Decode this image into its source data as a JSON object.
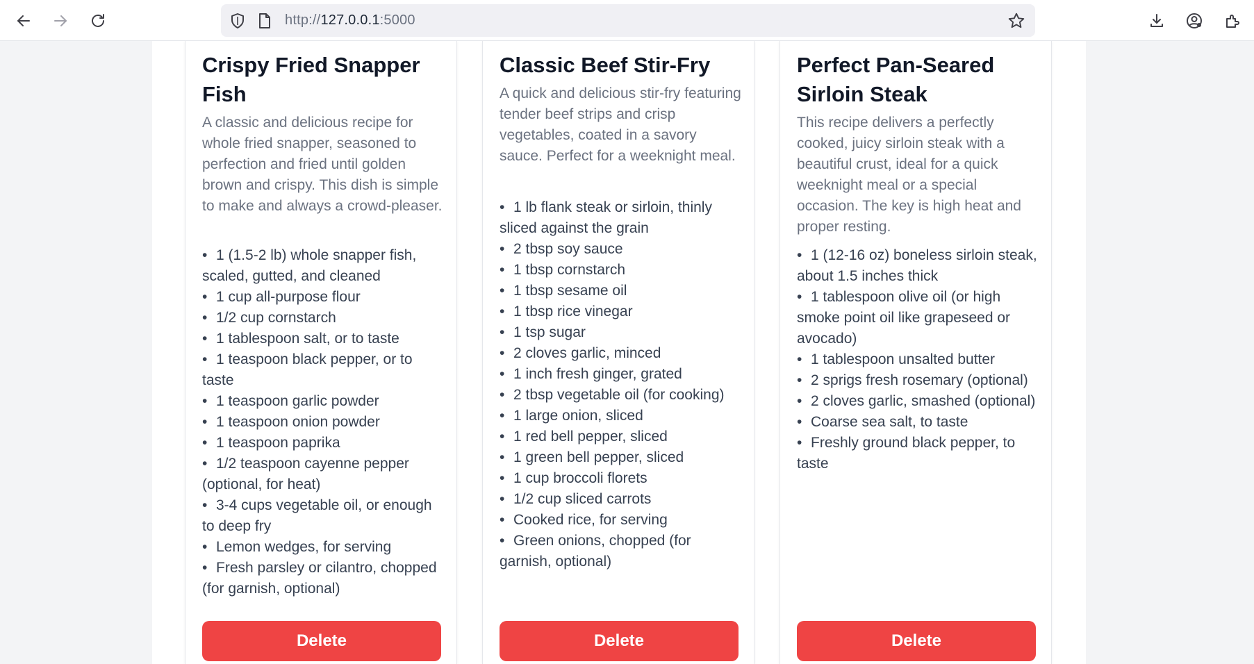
{
  "browser": {
    "url_prefix": "http://",
    "url_host": "127.0.0.1",
    "url_port": ":5000"
  },
  "recipes": [
    {
      "title": "Crispy Fried Snapper Fish",
      "description": "A classic and delicious recipe for whole fried snapper, seasoned to perfection and fried until golden brown and crispy. This dish is simple to make and always a crowd-pleaser.",
      "ingredients": [
        "1 (1.5-2 lb) whole snapper fish, scaled, gutted, and cleaned",
        "1 cup all-purpose flour",
        "1/2 cup cornstarch",
        "1 tablespoon salt, or to taste",
        "1 teaspoon black pepper, or to taste",
        "1 teaspoon garlic powder",
        "1 teaspoon onion powder",
        "1 teaspoon paprika",
        "1/2 teaspoon cayenne pepper (optional, for heat)",
        "3-4 cups vegetable oil, or enough to deep fry",
        "Lemon wedges, for serving",
        "Fresh parsley or cilantro, chopped (for garnish, optional)"
      ],
      "delete_label": "Delete"
    },
    {
      "title": "Classic Beef Stir-Fry",
      "description": "A quick and delicious stir-fry featuring tender beef strips and crisp vegetables, coated in a savory sauce. Perfect for a weeknight meal.",
      "ingredients": [
        "1 lb flank steak or sirloin, thinly sliced against the grain",
        "2 tbsp soy sauce",
        "1 tbsp cornstarch",
        "1 tbsp sesame oil",
        "1 tbsp rice vinegar",
        "1 tsp sugar",
        "2 cloves garlic, minced",
        "1 inch fresh ginger, grated",
        "2 tbsp vegetable oil (for cooking)",
        "1 large onion, sliced",
        "1 red bell pepper, sliced",
        "1 green bell pepper, sliced",
        "1 cup broccoli florets",
        "1/2 cup sliced carrots",
        "Cooked rice, for serving",
        "Green onions, chopped (for garnish, optional)"
      ],
      "delete_label": "Delete"
    },
    {
      "title": "Perfect Pan-Seared Sirloin Steak",
      "description": "This recipe delivers a perfectly cooked, juicy sirloin steak with a beautiful crust, ideal for a quick weeknight meal or a special occasion. The key is high heat and proper resting.",
      "ingredients": [
        "1 (12-16 oz) boneless sirloin steak, about 1.5 inches thick",
        "1 tablespoon olive oil (or high smoke point oil like grapeseed or avocado)",
        "1 tablespoon unsalted butter",
        "2 sprigs fresh rosemary (optional)",
        "2 cloves garlic, smashed (optional)",
        "Coarse sea salt, to taste",
        "Freshly ground black pepper, to taste"
      ],
      "delete_label": "Delete"
    }
  ],
  "colors": {
    "delete_button": "#ef4444",
    "title_text": "#111827",
    "description_text": "#6b7280",
    "ingredient_text": "#374151"
  },
  "icons": {
    "back": "arrow-left-icon",
    "forward": "arrow-right-icon",
    "reload": "reload-icon",
    "shield": "shield-icon",
    "page": "page-icon",
    "bookmark": "star-icon",
    "downloads": "download-icon",
    "account": "account-icon",
    "extensions": "extensions-icon"
  }
}
